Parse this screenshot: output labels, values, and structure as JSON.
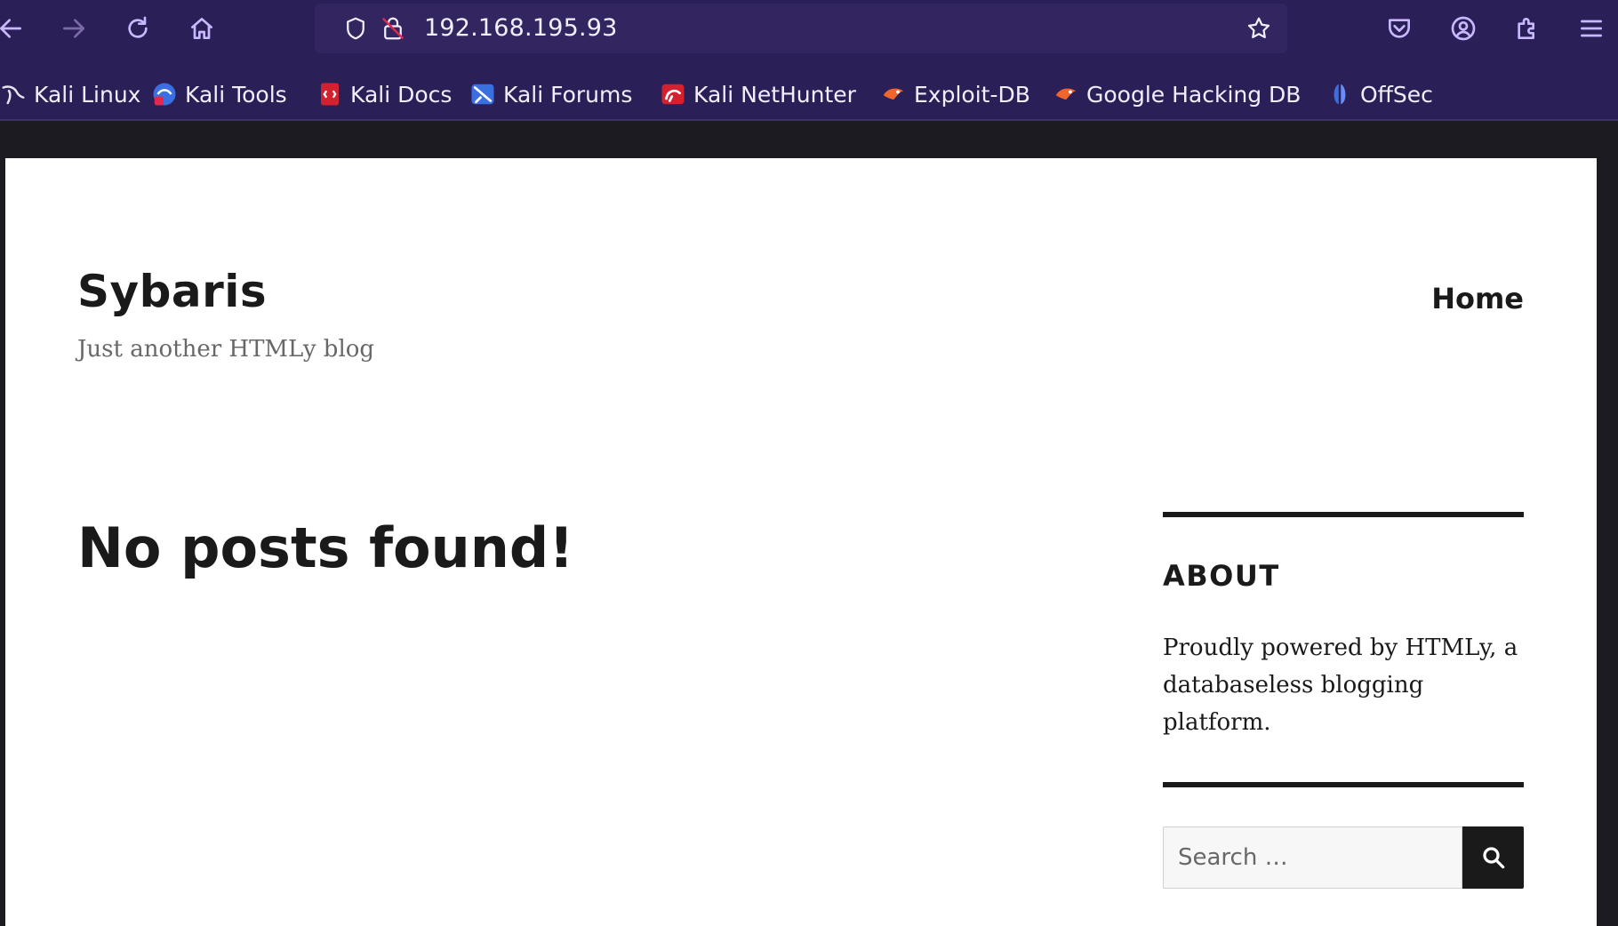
{
  "browser": {
    "url": "192.168.195.93",
    "toolbar": {
      "back_icon": "arrow-left",
      "forward_icon": "arrow-right",
      "reload_icon": "reload",
      "home_icon": "home",
      "bookmark_star_icon": "star",
      "pocket_icon": "pocket",
      "account_icon": "account",
      "extensions_icon": "puzzle",
      "menu_icon": "hamburger"
    },
    "bookmarks": [
      {
        "label": "Kali Linux",
        "icon": "kali-dragon"
      },
      {
        "label": "Kali Tools",
        "icon": "kali-tools"
      },
      {
        "label": "Kali Docs",
        "icon": "kali-docs"
      },
      {
        "label": "Kali Forums",
        "icon": "kali-forums"
      },
      {
        "label": "Kali NetHunter",
        "icon": "kali-nethunter"
      },
      {
        "label": "Exploit-DB",
        "icon": "exploit-db"
      },
      {
        "label": "Google Hacking DB",
        "icon": "exploit-db"
      },
      {
        "label": "OffSec",
        "icon": "offsec"
      }
    ],
    "colors": {
      "chrome_bg": "#2b1f57",
      "urlbar_bg": "#33255f",
      "chrome_text": "#f1efff"
    }
  },
  "site": {
    "title": "Sybaris",
    "description": "Just another HTMLy blog",
    "nav": {
      "home_label": "Home"
    },
    "main": {
      "heading": "No posts found!"
    },
    "sidebar": {
      "about_title": "ABOUT",
      "about_text": "Proudly powered by HTMLy, a databaseless blogging platform.",
      "search_placeholder": "Search …",
      "search_icon": "magnifier"
    }
  }
}
